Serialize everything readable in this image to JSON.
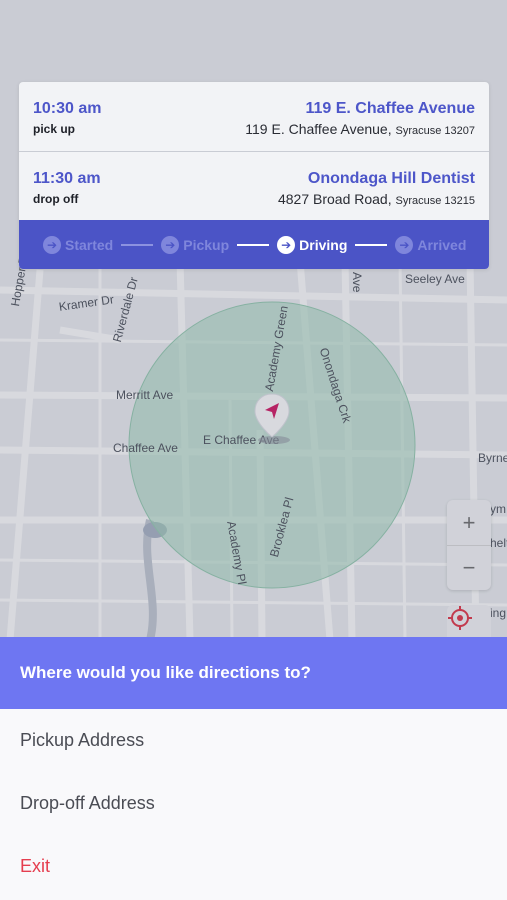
{
  "map": {
    "streets": [
      "Kramer Dr",
      "Riverdale Dr",
      "Academy Green",
      "Onondaga Crk",
      "Ave",
      "Seeley Ave",
      "Hopper Rd",
      "Merritt Ave",
      "Chaffee Ave",
      "E Chaffee Ave",
      "Byrne",
      "Academy Pl",
      "Brooklea Pl",
      "ym",
      "helt",
      "ing"
    ],
    "zoom_in_label": "+",
    "zoom_out_label": "−"
  },
  "trip": {
    "stops": [
      {
        "time": "10:30 am",
        "kind": "pick up",
        "name": "119 E. Chaffee Avenue",
        "street": "119 E. Chaffee Avenue,",
        "city": "Syracuse 13207"
      },
      {
        "time": "11:30 am",
        "kind": "drop off",
        "name": "Onondaga Hill Dentist",
        "street": "4827 Broad Road,",
        "city": "Syracuse 13215"
      }
    ],
    "steps": [
      {
        "label": "Started",
        "active": false
      },
      {
        "label": "Pickup",
        "active": false
      },
      {
        "label": "Driving",
        "active": true
      },
      {
        "label": "Arrived",
        "active": false
      }
    ]
  },
  "sheet": {
    "title": "Where would you like directions to?",
    "options": [
      "Pickup Address",
      "Drop-off Address"
    ],
    "exit_label": "Exit"
  },
  "colors": {
    "accent": "#4b54c6",
    "sheet_header": "#6e76f2",
    "exit": "#e53e4f",
    "marker": "#d6226b"
  }
}
